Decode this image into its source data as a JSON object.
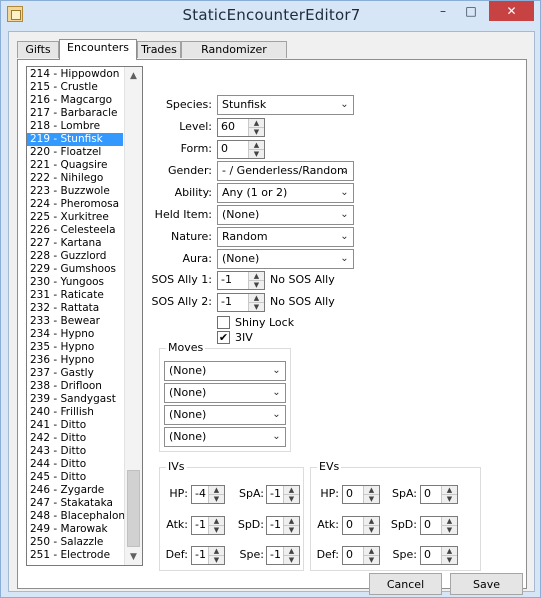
{
  "window": {
    "title": "StaticEncounterEditor7"
  },
  "title_controls": {
    "minimize": "–",
    "maximize": "□",
    "close": "✕"
  },
  "icons": {
    "app": "app-icon",
    "scroll_up": "▲",
    "scroll_down": "▼",
    "dropdown": "⌄",
    "spin_up": "▲",
    "spin_down": "▼",
    "check": "✔"
  },
  "tabs": [
    "Gifts",
    "Encounters",
    "Trades",
    "Randomizer Options"
  ],
  "active_tab": "Encounters",
  "encounter_list": {
    "items": [
      "214 - Hippowdon",
      "215 - Crustle",
      "216 - Magcargo",
      "217 - Barbaracle",
      "218 - Lombre",
      "219 - Stunfisk",
      "220 - Floatzel",
      "221 - Quagsire",
      "222 - Nihilego",
      "223 - Buzzwole",
      "224 - Pheromosa",
      "225 - Xurkitree",
      "226 - Celesteela",
      "227 - Kartana",
      "228 - Guzzlord",
      "229 - Gumshoos",
      "230 - Yungoos",
      "231 - Raticate",
      "232 - Rattata",
      "233 - Bewear",
      "234 - Hypno",
      "235 - Hypno",
      "236 - Hypno",
      "237 - Gastly",
      "238 - Drifloon",
      "239 - Sandygast",
      "240 - Frillish",
      "241 - Ditto",
      "242 - Ditto",
      "243 - Ditto",
      "244 - Ditto",
      "245 - Ditto",
      "246 - Zygarde",
      "247 - Stakataka",
      "248 - Blacephalon",
      "249 - Marowak",
      "250 - Salazzle",
      "251 - Electrode"
    ],
    "selected_index": 5
  },
  "form": {
    "species_label": "Species:",
    "species_value": "Stunfisk",
    "level_label": "Level:",
    "level_value": "60",
    "form_label": "Form:",
    "form_value": "0",
    "gender_label": "Gender:",
    "gender_value": "- / Genderless/Random",
    "ability_label": "Ability:",
    "ability_value": "Any (1 or 2)",
    "held_item_label": "Held Item:",
    "held_item_value": "(None)",
    "nature_label": "Nature:",
    "nature_value": "Random",
    "aura_label": "Aura:",
    "aura_value": "(None)",
    "sos1_label": "SOS Ally 1:",
    "sos1_value": "-1",
    "sos1_text": "No SOS Ally",
    "sos2_label": "SOS Ally 2:",
    "sos2_value": "-1",
    "sos2_text": "No SOS Ally",
    "shiny_label": "Shiny Lock",
    "shiny_checked": false,
    "three_iv_label": "3IV",
    "three_iv_checked": true
  },
  "moves": {
    "title": "Moves",
    "values": [
      "(None)",
      "(None)",
      "(None)",
      "(None)"
    ]
  },
  "ivs": {
    "title": "IVs",
    "labels": {
      "hp": "HP:",
      "atk": "Atk:",
      "def": "Def:",
      "spa": "SpA:",
      "spd": "SpD:",
      "spe": "Spe:"
    },
    "values": {
      "hp": "-4",
      "atk": "-1",
      "def": "-1",
      "spa": "-1",
      "spd": "-1",
      "spe": "-1"
    }
  },
  "evs": {
    "title": "EVs",
    "labels": {
      "hp": "HP:",
      "atk": "Atk:",
      "def": "Def:",
      "spa": "SpA:",
      "spd": "SpD:",
      "spe": "Spe:"
    },
    "values": {
      "hp": "0",
      "atk": "0",
      "def": "0",
      "spa": "0",
      "spd": "0",
      "spe": "0"
    }
  },
  "buttons": {
    "cancel": "Cancel",
    "save": "Save"
  }
}
